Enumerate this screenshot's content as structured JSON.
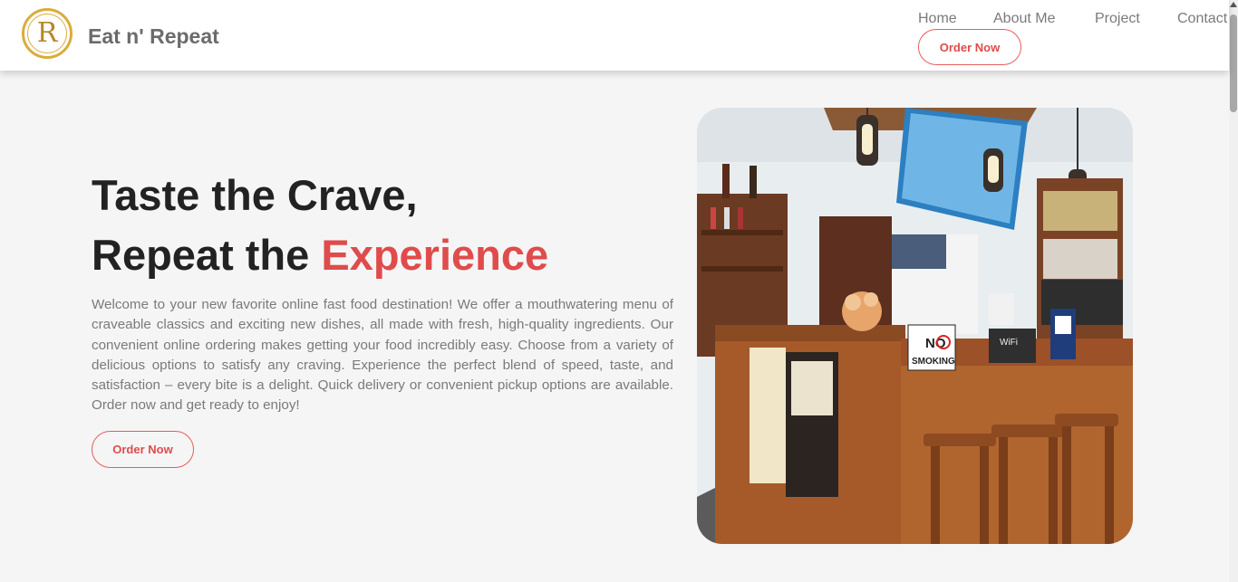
{
  "brand": {
    "name": "Eat n' Repeat",
    "logo_letter": "R"
  },
  "nav": {
    "items": [
      "Home",
      "About Me",
      "Project",
      "Contact"
    ],
    "order_button": "Order Now"
  },
  "hero": {
    "title_line1": "Taste the Crave,",
    "title_line2_prefix": "Repeat the ",
    "title_line2_accent": "Experience",
    "description": "Welcome to your new favorite online fast food destination! We offer a mouthwatering menu of craveable classics and exciting new dishes, all made with fresh, high-quality ingredients. Our convenient online ordering makes getting your food incredibly easy. Choose from a variety of delicious options to satisfy any craving. Experience the perfect blend of speed, taste, and satisfaction – every bite is a delight. Quick delivery or convenient pickup options are available. Order now and get ready to enjoy!",
    "order_button": "Order Now"
  },
  "photo": {
    "signs": {
      "no_smoking_1": "NO",
      "no_smoking_2": "SMOKING",
      "wifi": "WiFi"
    }
  },
  "colors": {
    "accent": "#e04b4b",
    "logo_gold": "#d9ad3c",
    "background": "#f5f5f5"
  }
}
